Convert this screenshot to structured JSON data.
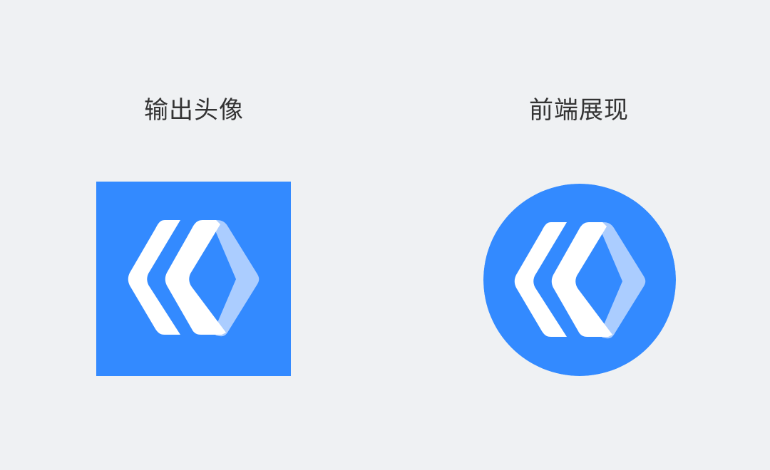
{
  "left": {
    "label": "输出头像"
  },
  "right": {
    "label": "前端展现"
  },
  "colors": {
    "background": "#eff1f3",
    "brand": "#338aff",
    "mark_primary": "#ffffff",
    "mark_secondary": "#abcdff",
    "label_text": "#333333"
  },
  "logo": {
    "icon": "brand-logo-icon"
  }
}
